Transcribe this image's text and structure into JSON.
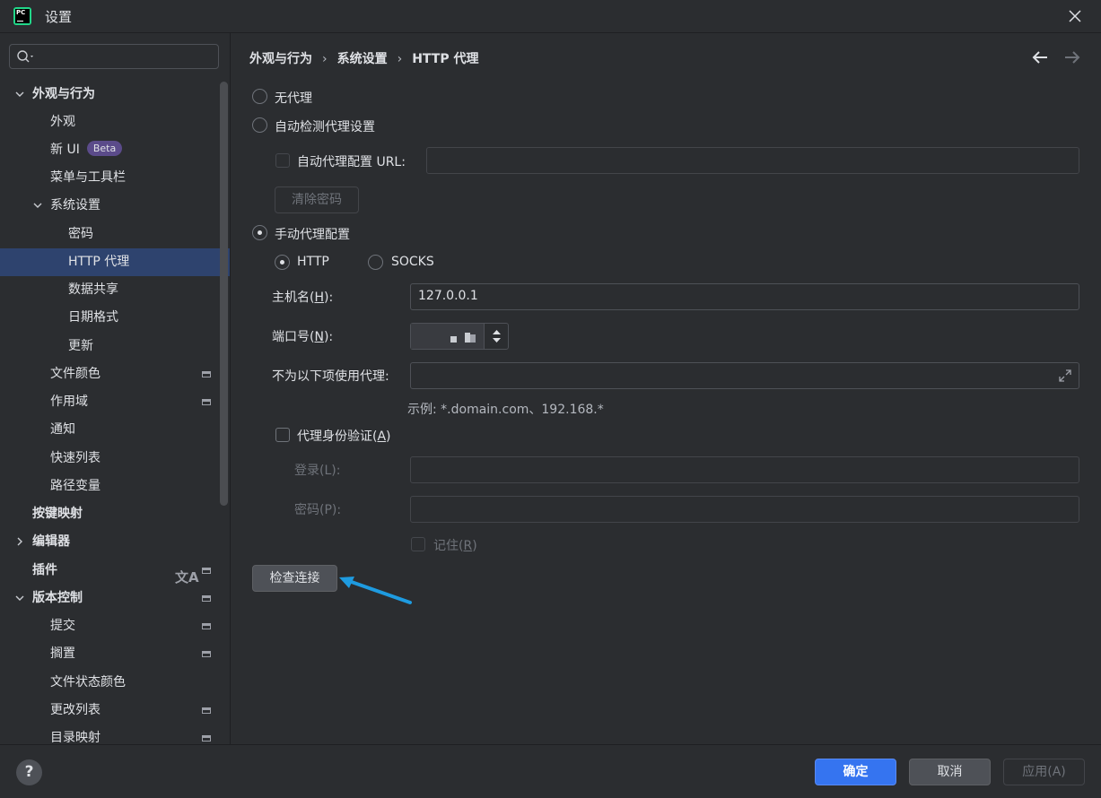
{
  "window": {
    "title": "设置",
    "logo_text": "PC"
  },
  "sidebar": {
    "search_placeholder": "",
    "items": [
      {
        "label": "外观与行为",
        "expanded": true
      },
      {
        "label": "外观"
      },
      {
        "label": "新 UI",
        "badge": "Beta"
      },
      {
        "label": "菜单与工具栏"
      },
      {
        "label": "系统设置",
        "expanded": true
      },
      {
        "label": "密码"
      },
      {
        "label": "HTTP 代理",
        "selected": true
      },
      {
        "label": "数据共享"
      },
      {
        "label": "日期格式"
      },
      {
        "label": "更新"
      },
      {
        "label": "文件颜色"
      },
      {
        "label": "作用域"
      },
      {
        "label": "通知"
      },
      {
        "label": "快速列表"
      },
      {
        "label": "路径变量"
      },
      {
        "label": "按键映射"
      },
      {
        "label": "编辑器",
        "expanded": false
      },
      {
        "label": "插件"
      },
      {
        "label": "版本控制",
        "expanded": true
      },
      {
        "label": "提交"
      },
      {
        "label": "搁置"
      },
      {
        "label": "文件状态颜色"
      },
      {
        "label": "更改列表"
      },
      {
        "label": "目录映射"
      }
    ]
  },
  "breadcrumb": [
    "外观与行为",
    "系统设置",
    "HTTP 代理"
  ],
  "proxy": {
    "no_proxy_label": "无代理",
    "auto_detect_label": "自动检测代理设置",
    "auto_config_url_label": "自动代理配置 URL:",
    "auto_config_url_value": "",
    "clear_password_label": "清除密码",
    "manual_label": "手动代理配置",
    "mode": "manual",
    "protocol_http_label": "HTTP",
    "protocol_socks_label": "SOCKS",
    "protocol": "HTTP",
    "hostname_label_pre": "主机名(",
    "hostname_mnemonic": "H",
    "hostname_label_post": "):",
    "hostname_value": "127.0.0.1",
    "port_label_pre": "端口号(",
    "port_mnemonic": "N",
    "port_label_post": "):",
    "no_proxy_for_label": "不为以下项使用代理:",
    "no_proxy_for_value": "",
    "example_hint": "示例: *.domain.com、192.168.*",
    "auth_label_pre": "代理身份验证(",
    "auth_mnemonic": "A",
    "auth_label_post": ")",
    "auth_enabled": false,
    "login_label": "登录(L):",
    "password_label": "密码(P):",
    "remember_label_pre": "记住(",
    "remember_mnemonic": "R",
    "remember_label_post": ")",
    "check_connection_label": "检查连接"
  },
  "footer": {
    "help_label": "?",
    "ok_label": "确定",
    "cancel_label": "取消",
    "apply_label": "应用(A)"
  },
  "colors": {
    "background": "#2b2d30",
    "selected": "#2e436e",
    "accent": "#3574f0",
    "annotation_arrow": "#1e9be0"
  }
}
